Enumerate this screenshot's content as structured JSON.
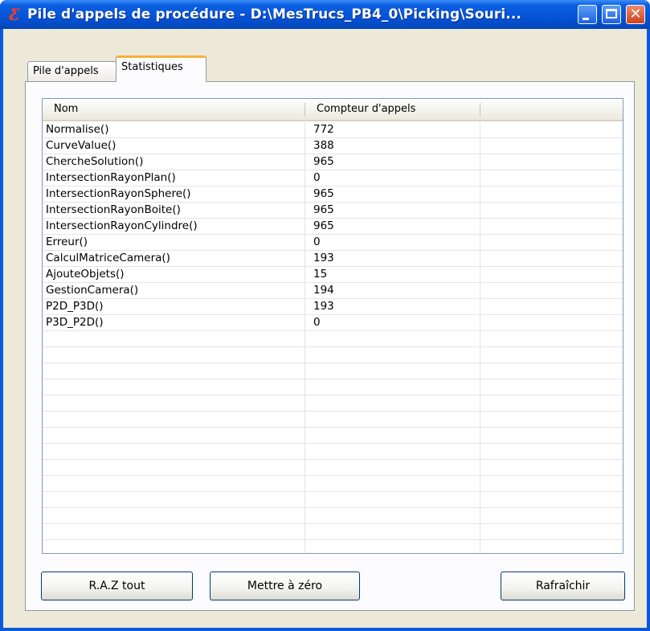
{
  "window": {
    "title": "Pile d'appels de procédure - D:\\MesTrucs_PB4_0\\Picking\\Souri...",
    "icon_glyph": "Ƹ",
    "close_glyph": "✕"
  },
  "tabs": [
    {
      "label": "Pile d'appels",
      "selected": false
    },
    {
      "label": "Statistiques",
      "selected": true
    }
  ],
  "table": {
    "columns": [
      "Nom",
      "Compteur d'appels"
    ],
    "rows": [
      {
        "name": "Normalise()",
        "count": "772"
      },
      {
        "name": "CurveValue()",
        "count": "388"
      },
      {
        "name": "ChercheSolution()",
        "count": "965"
      },
      {
        "name": "IntersectionRayonPlan()",
        "count": "0"
      },
      {
        "name": "IntersectionRayonSphere()",
        "count": "965"
      },
      {
        "name": "IntersectionRayonBoite()",
        "count": "965"
      },
      {
        "name": "IntersectionRayonCylindre()",
        "count": "965"
      },
      {
        "name": "Erreur()",
        "count": "0"
      },
      {
        "name": "CalculMatriceCamera()",
        "count": "193"
      },
      {
        "name": "AjouteObjets()",
        "count": "15"
      },
      {
        "name": "GestionCamera()",
        "count": "194"
      },
      {
        "name": "P2D_P3D()",
        "count": "193"
      },
      {
        "name": "P3D_P2D()",
        "count": "0"
      }
    ]
  },
  "buttons": {
    "reset_all": "R.A.Z tout",
    "reset": "Mettre à zéro",
    "refresh": "Rafraîchir"
  },
  "colors": {
    "titlebar": "#0553d6",
    "client_bg": "#ece9d8",
    "close_button": "#d2421b",
    "tab_highlight": "#f7b03c"
  }
}
